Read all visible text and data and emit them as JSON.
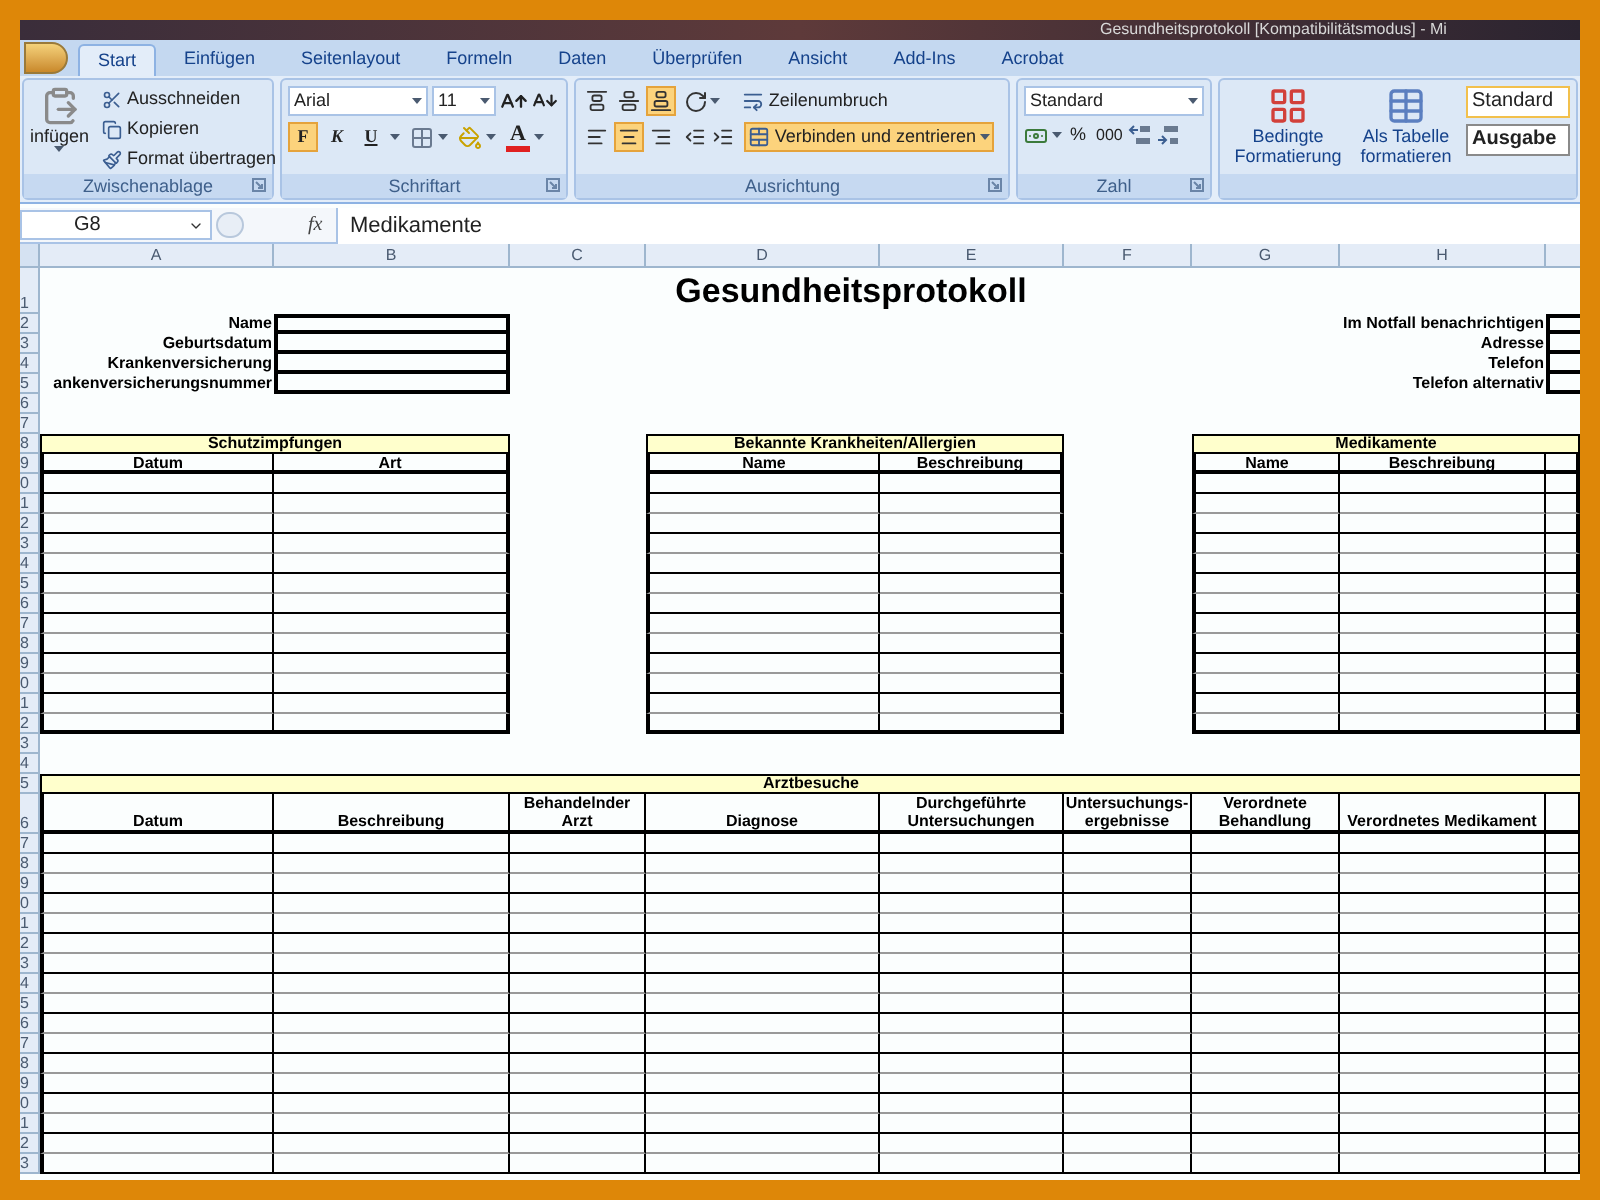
{
  "window": {
    "title": "Gesundheitsprotokoll [Kompatibilitätsmodus] - Mi"
  },
  "ribbon": {
    "tabs": [
      {
        "label": "Start",
        "selected": true
      },
      {
        "label": "Einfügen",
        "selected": false
      },
      {
        "label": "Seitenlayout",
        "selected": false
      },
      {
        "label": "Formeln",
        "selected": false
      },
      {
        "label": "Daten",
        "selected": false
      },
      {
        "label": "Überprüfen",
        "selected": false
      },
      {
        "label": "Ansicht",
        "selected": false
      },
      {
        "label": "Add-Ins",
        "selected": false
      },
      {
        "label": "Acrobat",
        "selected": false
      }
    ],
    "clipboard": {
      "label": "Zwischenablage",
      "paste": "infügen",
      "items": [
        "Ausschneiden",
        "Kopieren",
        "Format übertragen"
      ]
    },
    "font": {
      "label": "Schriftart",
      "font_name": "Arial",
      "font_size": "11",
      "styles": [
        {
          "text": "F",
          "selected": true
        },
        {
          "text": "K",
          "selected": false
        },
        {
          "text": "U",
          "selected": false
        }
      ],
      "font_color_letter": "A"
    },
    "alignment": {
      "label": "Ausrichtung",
      "vertical": [
        {
          "selected": false
        },
        {
          "selected": false
        },
        {
          "selected": true
        }
      ],
      "horizontal": [
        {
          "selected": false
        },
        {
          "selected": true
        },
        {
          "selected": false
        }
      ],
      "wrap": "Zeilenumbruch",
      "merge": {
        "text": "Verbinden und zentrieren",
        "selected": true
      }
    },
    "number": {
      "label": "Zahl",
      "format": "Standard",
      "percent": "%",
      "thousands": "000"
    },
    "styles": {
      "conditional": "Bedingte Formatierung",
      "table": "Als Tabelle formatieren",
      "cells": [
        "Standard",
        "Ausgabe"
      ]
    }
  },
  "formula_bar": {
    "name_box": "G8",
    "function_label": "fx",
    "formula": "Medikamente"
  },
  "sheet": {
    "columns": [
      "A",
      "B",
      "C",
      "D",
      "E",
      "F",
      "G",
      "H"
    ],
    "row_numbers": [
      "1",
      "2",
      "3",
      "4",
      "5",
      "6",
      "7",
      "8",
      "9",
      "0",
      "1",
      "2",
      "3",
      "4",
      "5",
      "6",
      "7",
      "8",
      "9",
      "0",
      "1",
      "2",
      "3",
      "4",
      "5",
      "6",
      "7",
      "8",
      "9",
      "0",
      "1",
      "2",
      "3",
      "4",
      "5",
      "6",
      "7",
      "8",
      "9",
      "0",
      "1",
      "2",
      "3"
    ],
    "title": "Gesundheitsprotokoll",
    "personal": [
      "Name",
      "Geburtsdatum",
      "Krankenversicherung",
      "ankenversicherungsnummer"
    ],
    "emergency": [
      "Im Notfall benachrichtigen",
      "Adresse",
      "Telefon",
      "Telefon alternativ"
    ],
    "tables": [
      {
        "title": "Schutzimpfungen",
        "columns": [
          "Datum",
          "Art"
        ]
      },
      {
        "title": "Bekannte Krankheiten/Allergien",
        "columns": [
          "Name",
          "Beschreibung"
        ]
      },
      {
        "title": "Medikamente",
        "columns": [
          "Name",
          "Beschreibung"
        ]
      }
    ],
    "visits": {
      "title": "Arztbesuche",
      "columns": [
        "Datum",
        "Beschreibung",
        "Behandelnder Arzt",
        "Diagnose",
        "Durchgeführte Untersuchungen",
        "Untersuchungs-ergebnisse",
        "Verordnete Behandlung",
        "Verordnetes Medikament"
      ]
    }
  }
}
